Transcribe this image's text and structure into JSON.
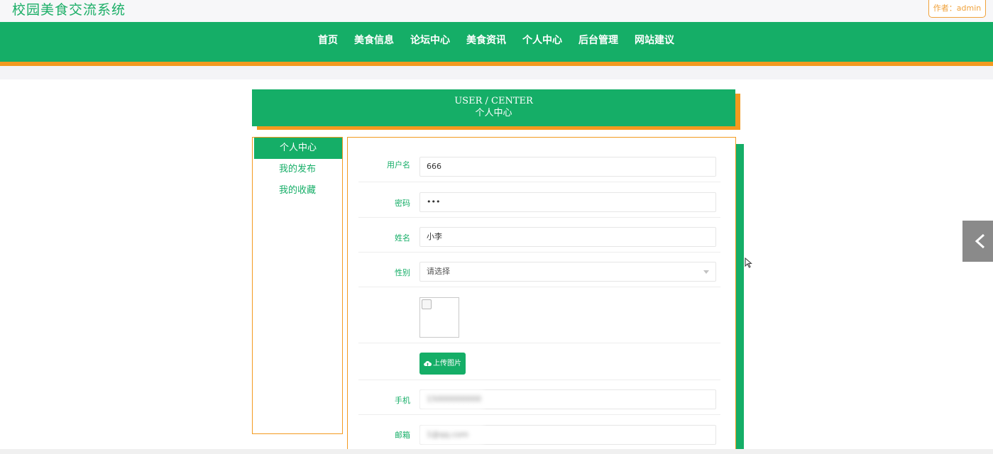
{
  "header": {
    "site_title": "校园美食交流系统",
    "author_badge": "作者：admin"
  },
  "nav": {
    "items": [
      {
        "label": "首页"
      },
      {
        "label": "美食信息"
      },
      {
        "label": "论坛中心"
      },
      {
        "label": "美食资讯"
      },
      {
        "label": "个人中心"
      },
      {
        "label": "后台管理"
      },
      {
        "label": "网站建议"
      }
    ]
  },
  "banner": {
    "en_title": "USER / CENTER",
    "cn_title": "个人中心"
  },
  "sidebar": {
    "items": [
      {
        "label": "个人中心",
        "active": true
      },
      {
        "label": "我的发布",
        "active": false
      },
      {
        "label": "我的收藏",
        "active": false
      }
    ]
  },
  "form": {
    "username": {
      "label": "用户名",
      "value": "666"
    },
    "password": {
      "label": "密码",
      "value": "•••"
    },
    "name": {
      "label": "姓名",
      "value": "小李"
    },
    "gender": {
      "label": "性别",
      "value": "请选择"
    },
    "upload_label": "上传图片",
    "phone": {
      "label": "手机",
      "value": "15000000000"
    },
    "email": {
      "label": "邮箱",
      "value": "1@qq.com"
    }
  },
  "colors": {
    "primary": "#15ae67",
    "accent": "#f39a1f"
  },
  "icons": {
    "upload": "cloud-upload-icon",
    "back": "chevron-left-icon"
  }
}
